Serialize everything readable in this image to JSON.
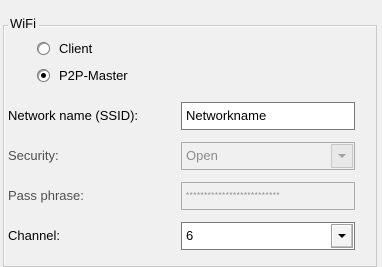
{
  "wifi_group": {
    "title": "WiFi",
    "mode_options": [
      {
        "label": "Client",
        "selected": false
      },
      {
        "label": "P2P-Master",
        "selected": true
      }
    ],
    "network_name": {
      "label": "Network name (SSID):",
      "value": "Networkname"
    },
    "security": {
      "label": "Security:",
      "value": "Open",
      "enabled": false
    },
    "pass_phrase": {
      "label": "Pass phrase:",
      "value": "**************************",
      "enabled": false
    },
    "channel": {
      "label": "Channel:",
      "value": "6",
      "enabled": true
    }
  },
  "icons": {
    "dropdown": "chevron-down-icon",
    "radio_selected": "radio-dot-icon"
  }
}
